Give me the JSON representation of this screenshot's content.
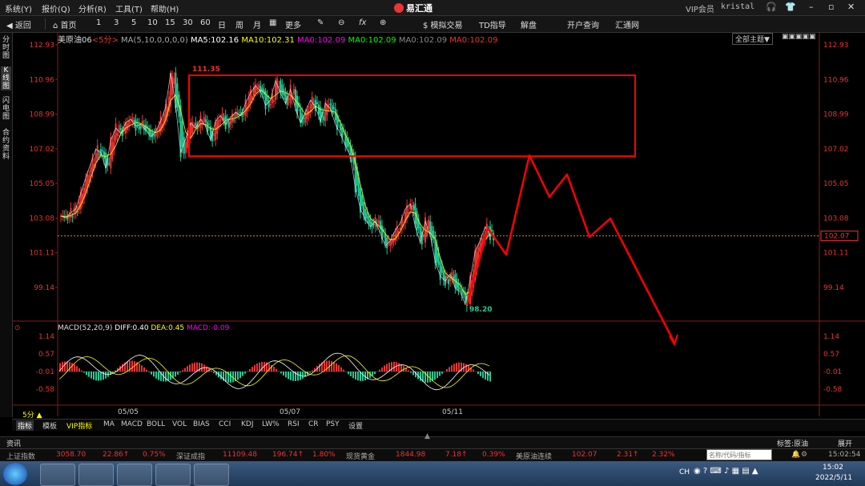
{
  "menubar": {
    "items": [
      "系统(Y)",
      "报价(Q)",
      "分析(R)",
      "工具(T)",
      "帮助(H)"
    ],
    "app_title": "易汇通",
    "vip": "VIP会员",
    "user": "kristal"
  },
  "toolbar": {
    "back": "返回",
    "home": "首页",
    "periods": [
      "1",
      "3",
      "5",
      "10",
      "15",
      "30",
      "60",
      "日",
      "周",
      "月"
    ],
    "more": "更多",
    "fx": "fx",
    "sim_trade": "模拟交易",
    "td": "TD指导",
    "unlock": "解盘",
    "open_account": "开户查询",
    "huitong": "汇通网"
  },
  "side_tabs": [
    "分时图",
    "K线图",
    "闪电图",
    "合约资料"
  ],
  "chart_header": {
    "symbol": "美原油06",
    "period": "<5分>",
    "ma_params": "MA(5,10,0,0,0,0)",
    "ma5": "MA5:102.16",
    "ma10": "MA10:102.31",
    "ma0a": "MA0:102.09",
    "ma0b": "MA0:102.09",
    "ma0c": "MA0:102.09",
    "ma0d": "MA0:102.09",
    "main_theme": "全部主题▼"
  },
  "annotations": {
    "high": "111.35",
    "low": "98.20",
    "current_price": "102.07"
  },
  "chart_data": {
    "type": "candlestick",
    "ylim": [
      98.2,
      113.5
    ],
    "yticks_left": [
      "112.93",
      "110.96",
      "108.99",
      "107.02",
      "105.05",
      "103.08",
      "101.11",
      "99.14"
    ],
    "yticks_right": [
      "112.93",
      "110.96",
      "108.99",
      "107.02",
      "105.05",
      "103.08",
      "101.11",
      "99.14"
    ],
    "x_labels": [
      "05/05",
      "05/07",
      "05/11"
    ],
    "price_path": [
      103.2,
      103.1,
      103.4,
      103.6,
      104.5,
      105.4,
      106.2,
      107.0,
      106.8,
      105.9,
      107.5,
      108.2,
      107.9,
      108.5,
      108.7,
      108.3,
      108.4,
      108.1,
      107.7,
      108.0,
      108.6,
      109.4,
      111.35,
      109.5,
      106.8,
      107.6,
      108.5,
      108.2,
      108.7,
      108.3,
      107.5,
      108.6,
      108.9,
      108.4,
      108.8,
      109.1,
      108.9,
      109.6,
      110.2,
      110.6,
      110.3,
      109.5,
      109.8,
      110.9,
      110.2,
      109.6,
      110.4,
      109.3,
      108.5,
      109.1,
      109.8,
      109.4,
      108.6,
      109.6,
      109.3,
      108.4,
      107.9,
      107.2,
      106.6,
      104.8,
      103.6,
      103.0,
      102.6,
      102.9,
      102.2,
      101.5,
      101.8,
      102.4,
      102.8,
      103.6,
      103.9,
      102.6,
      101.7,
      102.9,
      102.1,
      100.6,
      99.8,
      99.5,
      99.9,
      99.1,
      98.9,
      98.2,
      99.6,
      101.2,
      101.8,
      102.6,
      102.07
    ],
    "projection": [
      [
        98.2,
        0
      ],
      [
        102.6,
        0
      ],
      [
        101.1,
        0
      ],
      [
        106.7,
        0
      ],
      [
        104.4,
        0
      ],
      [
        105.6,
        0
      ],
      [
        102.2,
        0
      ],
      [
        103.1,
        0
      ],
      [
        95.7,
        0
      ]
    ],
    "box": {
      "price_high": 111.2,
      "price_low": 106.6
    },
    "macd": {
      "title": "MACD(52,20,9)",
      "diff": "DIFF:0.40",
      "dea": "DEA:0.45",
      "macd": "MACD:-0.09",
      "yticks": [
        "1.14",
        "0.57",
        "-0.01",
        "-0.58"
      ]
    }
  },
  "indicator_tabs": [
    "指标",
    "模板",
    "VIP指标",
    "MA",
    "MACD",
    "BOLL",
    "VOL",
    "BIAS",
    "CCI",
    "KDJ",
    "LW%",
    "RSI",
    "CR",
    "PSY",
    "设置"
  ],
  "period_badge": "5分 ▲",
  "news": {
    "label": "资讯",
    "tag": "标签:原油",
    "expand": "展开"
  },
  "ticker": [
    {
      "name": "上证指数",
      "price": "3058.70",
      "chg": "22.86↑",
      "pct": "0.75%"
    },
    {
      "name": "深证成指",
      "price": "11109.48",
      "chg": "196.74↑",
      "pct": "1.80%"
    },
    {
      "name": "现货黄金",
      "price": "1844.98",
      "chg": "7.18↑",
      "pct": "0.39%"
    },
    {
      "name": "美原油连续",
      "price": "102.07",
      "chg": "2.31↑",
      "pct": "2.32%"
    }
  ],
  "search_placeholder": "名称/代码/指标",
  "time": "15:02:54",
  "taskbar": {
    "clock": "15:02",
    "date": "2022/5/11",
    "ime": "CH"
  }
}
